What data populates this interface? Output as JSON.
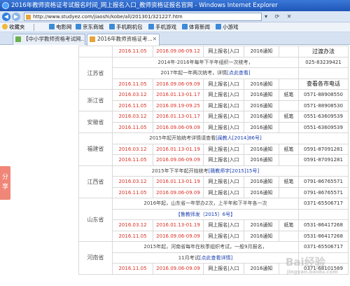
{
  "window": {
    "title": "2016年教师资格证考试报名时间_网上报名入口_教师资格证报名官网 - Windows Internet Explorer"
  },
  "address": {
    "url": "http://www.studyez.com/jiaoshi/kobe/all/201301/321227.htm"
  },
  "favorites": {
    "label": "收藏夹",
    "items": [
      "电影网",
      "京东商城",
      "手机刷机包",
      "手机游戏",
      "体育新闻",
      "小游戏"
    ]
  },
  "tabs": [
    {
      "label": "【中小学教师资格考试网..."
    },
    {
      "label": "2016年教师资格证考..."
    }
  ],
  "share": {
    "label": "分享"
  },
  "table": {
    "rows": [
      {
        "type": "data",
        "date": "2016.11.05",
        "reg": "2016.09.06-09.12",
        "entry": "网上报名|入口",
        "notice": "2016通知",
        "extra": "",
        "info": "",
        "info_head": "过渡办法"
      },
      {
        "type": "note",
        "province": "江苏省",
        "text": "2014年-2016年每年下半年组织一次统考，",
        "info": "025-83239421"
      },
      {
        "type": "note-link",
        "text": "2017年起一年两次统考，详情",
        "link": "[点此查看]",
        "info": ""
      },
      {
        "type": "data",
        "date": "2016.11.05",
        "reg": "2016.09.06-09.09",
        "entry": "网上报名|入口",
        "notice": "2016通知",
        "extra": "",
        "info_head": "查看各市电话"
      },
      {
        "type": "data",
        "province": "浙江省",
        "date": "2016.03.12",
        "reg": "2016.01.13-01.17",
        "entry": "网上报名|入口",
        "notice": "2016通知",
        "extra": "纸笔",
        "info": "0571-88908550"
      },
      {
        "type": "data",
        "date": "2016.11.05",
        "reg": "2016.09.19-09.25",
        "entry": "网上报名|入口",
        "notice": "2016通知",
        "extra": "",
        "info": "0571-88908530"
      },
      {
        "type": "data",
        "province": "安徽省",
        "date": "2016.03.12",
        "reg": "2016.01.13-01.17",
        "entry": "网上报名|入口",
        "notice": "2016通知",
        "extra": "纸笔",
        "info": "0551-63609539"
      },
      {
        "type": "data",
        "date": "2016.11.05",
        "reg": "2016.09.06-09.09",
        "entry": "网上报名|入口",
        "notice": "2016通知",
        "extra": "",
        "info": "0551-63609539"
      },
      {
        "type": "note-link",
        "province": "福建省",
        "text": "2015年起开始统考详情请查看",
        "link": "[闽教人[2014]86号]",
        "info": ""
      },
      {
        "type": "data",
        "date": "2016.03.12",
        "reg": "2016.01.13-01.19",
        "entry": "网上报名|入口",
        "notice": "2016通知",
        "extra": "纸笔",
        "info": "0591-87091281"
      },
      {
        "type": "data",
        "date": "2016.11.05",
        "reg": "2016.09.06-09.09",
        "entry": "网上报名|入口",
        "notice": "2016通知",
        "extra": "",
        "info": "0591-87091281"
      },
      {
        "type": "note-link",
        "province": "江西省",
        "text": "2015年下半年起开始统考",
        "link": "[赣教师字[2015]15号]",
        "info": ""
      },
      {
        "type": "data",
        "date": "2016.03.12",
        "reg": "2016.01.13-01.19",
        "entry": "网上报名|入口",
        "notice": "2016通知",
        "extra": "纸笔",
        "info": "0791-86765571"
      },
      {
        "type": "data",
        "date": "2016.11.05",
        "reg": "2016.09.06-09.09",
        "entry": "网上报名|入口",
        "notice": "2016通知",
        "extra": "",
        "info": "0791-86765571"
      },
      {
        "type": "note",
        "province": "山东省",
        "text": "2016年起，山东省一年举办2次，上半年和下半年各一次",
        "info": "0371-65506717"
      },
      {
        "type": "note-link",
        "text": "",
        "link": "【鲁教师发〔2015〕6号】",
        "info": ""
      },
      {
        "type": "data",
        "date": "2016.03.12",
        "reg": "2016.01.13-01.19",
        "entry": "网上报名|入口",
        "notice": "2016通知",
        "extra": "纸笔",
        "info": "0531-86417268"
      },
      {
        "type": "data",
        "date": "2016.11.05",
        "reg": "2016.09.06-09.09",
        "entry": "网上报名|入口",
        "notice": "2016通知",
        "extra": "",
        "info": "0531-86417268"
      },
      {
        "type": "note",
        "province": "河南省",
        "text": "2015年起，河南省每年在秋季组织考试，一般9月报名，",
        "info": "0371-65506717"
      },
      {
        "type": "note-link",
        "text": "11月考试",
        "link": "[点此查看详情]",
        "info": ""
      },
      {
        "type": "data",
        "date": "2016.11.05",
        "reg": "2016.09.06-09.09",
        "entry": "网上报名|入口",
        "notice": "2016通知",
        "extra": "",
        "info": "0371-68101589"
      }
    ]
  },
  "watermark": {
    "text": "Bai经验",
    "sub": "jingyan.baidu.com"
  }
}
